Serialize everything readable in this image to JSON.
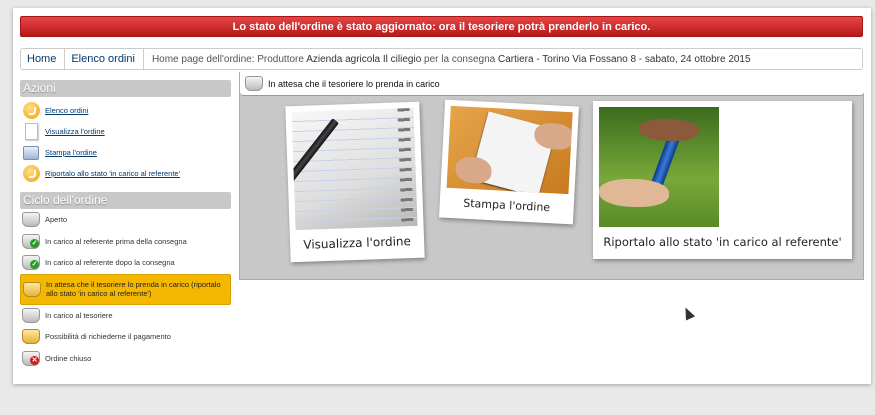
{
  "alert": {
    "message": "Lo stato dell'ordine è stato aggiornato: ora il tesoriere potrà prenderlo in carico.",
    "color": "#d62c2c"
  },
  "breadcrumb": {
    "items": [
      "Home",
      "Elenco ordini"
    ],
    "desc_prefix": "Home page dell'ordine:",
    "producer_label": "Produttore",
    "producer": "Azienda agricola Il ciliegio",
    "delivery_label": "per la consegna",
    "delivery": "Cartiera - Torino Via Fossano 8 - sabato, 24 ottobre 2015"
  },
  "sidebar": {
    "actions_title": "Azioni",
    "actions": [
      {
        "label": "Elenco ordini",
        "icon": "arrow-circle-icon"
      },
      {
        "label": "Visualizza l'ordine",
        "icon": "document-icon"
      },
      {
        "label": "Stampa l'ordine",
        "icon": "printer-icon"
      },
      {
        "label": "Riportalo allo stato 'in carico al referente'",
        "icon": "arrow-circle-icon"
      }
    ],
    "cycle_title": "Ciclo dell'ordine",
    "cycle": [
      {
        "label": "Aperto",
        "badge": ""
      },
      {
        "label": "In carico al referente prima della consegna",
        "badge": "✓"
      },
      {
        "label": "In carico al referente dopo la consegna",
        "badge": "✓"
      },
      {
        "label": "In attesa che il tesoriere lo prenda in carico (riportalo allo stato 'in carico al referente')",
        "badge": "",
        "active": true
      },
      {
        "label": "In carico al tesoriere",
        "badge": ""
      },
      {
        "label": "Possibilità di richiederne il pagamento",
        "badge": ""
      },
      {
        "label": "Ordine chiuso",
        "badge": "✕"
      }
    ],
    "active_color": "#f5b800"
  },
  "main": {
    "status_title": "In attesa che il tesoriere lo prenda in carico",
    "cards": [
      {
        "caption": "Visualizza l'ordine"
      },
      {
        "caption": "Stampa l'ordine"
      },
      {
        "caption": "Riportalo allo stato 'in carico al referente'"
      }
    ]
  }
}
